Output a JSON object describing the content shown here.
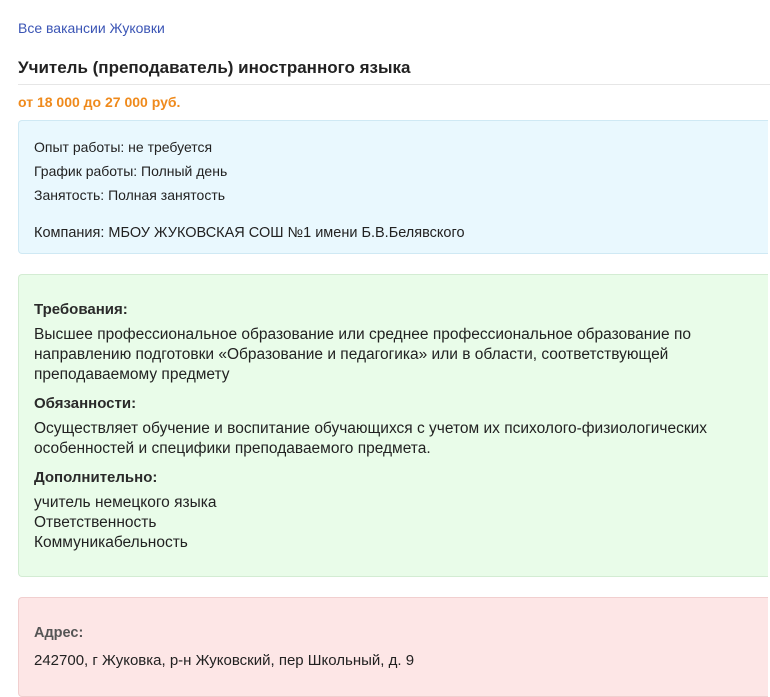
{
  "nav": {
    "back_link": "Все вакансии Жуковки"
  },
  "vacancy": {
    "title": "Учитель (преподаватель) иностранного языка",
    "salary": "от 18 000 до 27 000 руб.",
    "info": {
      "experience": "Опыт работы: не требуется",
      "schedule": "График работы: Полный день",
      "employment": "Занятость: Полная занятость",
      "company": "Компания: МБОУ ЖУКОВСКАЯ СОШ №1 имени Б.В.Белявского"
    },
    "requirements": {
      "heading": "Требования:",
      "text": "Высшее профессиональное образование или среднее профессиональное образование по направлению подготовки «Образование и педагогика» или в области, соответствующей преподаваемому предмету"
    },
    "duties": {
      "heading": "Обязанности:",
      "text": "Осуществляет обучение и воспитание обучающихся с учетом их психолого-физиологических особенностей и специфики преподаваемого предмета."
    },
    "additional": {
      "heading": "Дополнительно:",
      "items": [
        "учитель немецкого языка",
        "Ответственность",
        "Коммуникабельность"
      ]
    },
    "address": {
      "heading": "Адрес:",
      "text": "242700, г Жуковка, р-н Жуковский, пер Школьный, д. 9"
    }
  },
  "colors": {
    "link": "#3b55b5",
    "salary": "#ef8a1c",
    "info_bg": "#e9f8fe",
    "details_bg": "#e9fce9",
    "address_bg": "#fde6e6"
  }
}
